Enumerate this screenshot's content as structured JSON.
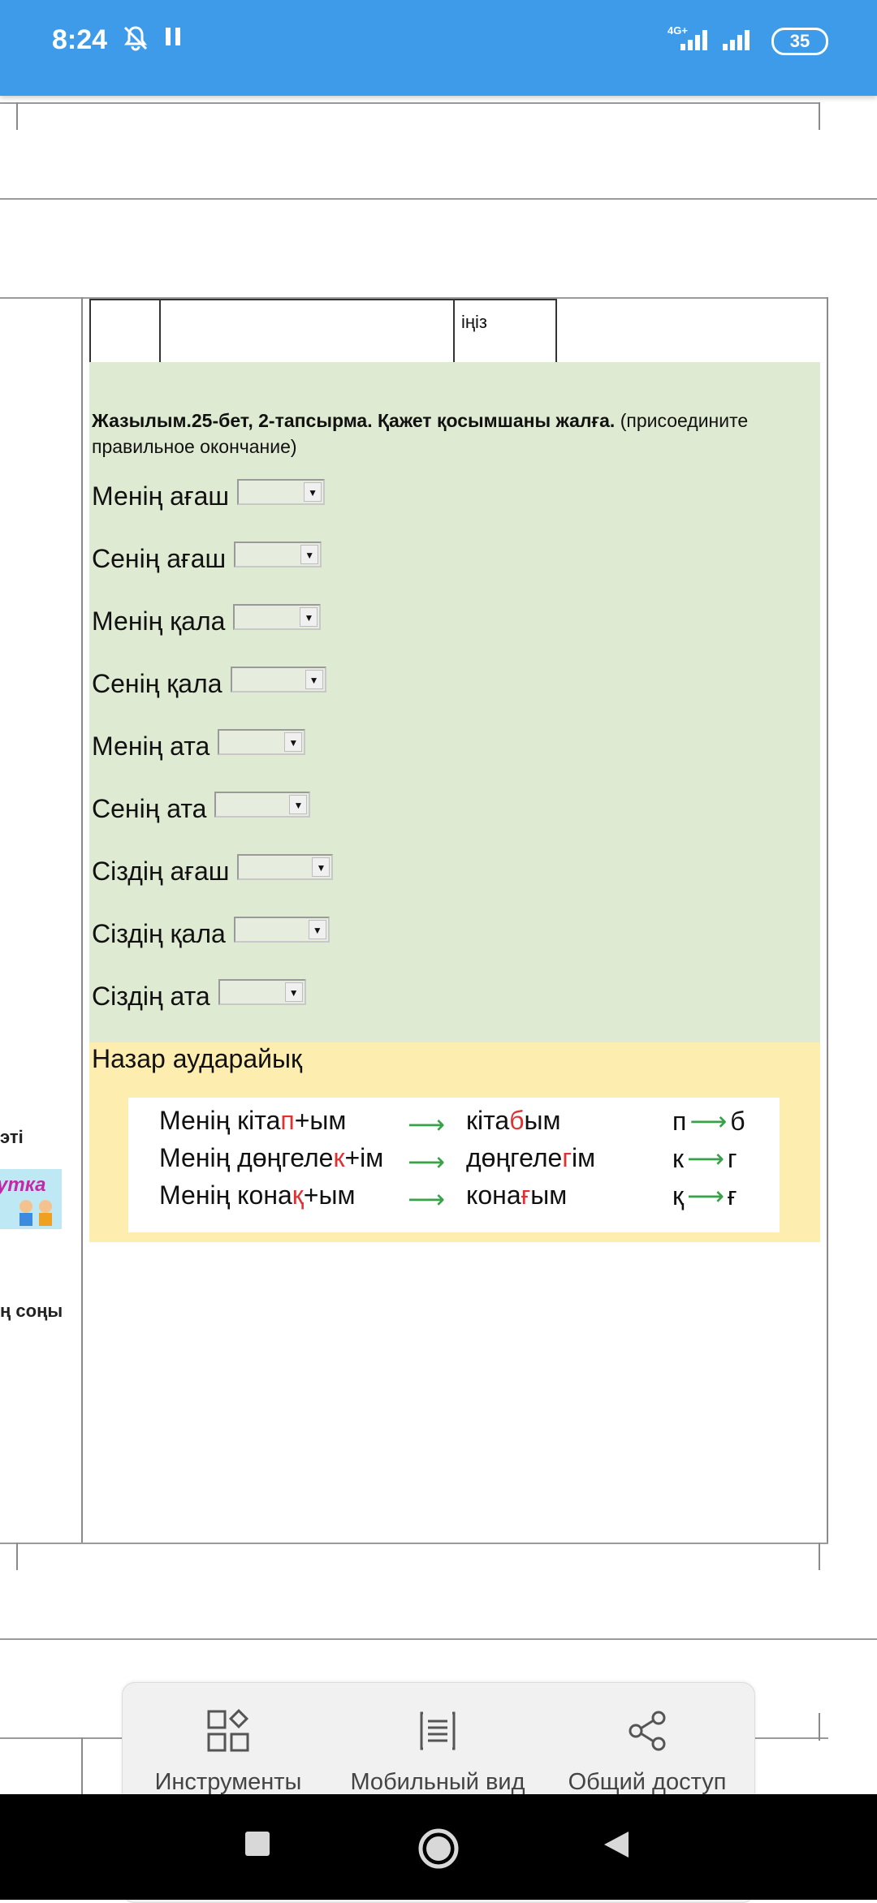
{
  "status_bar": {
    "time": "8:24",
    "network": "4G+",
    "battery": "35"
  },
  "table_fragment": {
    "cell_text": "іңіз"
  },
  "exercise": {
    "title_bold": "Жазылым.25-бет, 2-тапсырма. Қажет қосымшаны жалға.",
    "title_rest": "(присоедините правильное окончание)",
    "items": [
      {
        "text": "Менің ағаш"
      },
      {
        "text": "Сенің ағаш"
      },
      {
        "text": "Менің қала"
      },
      {
        "text": "Сенің қала"
      },
      {
        "text": "Менің ата"
      },
      {
        "text": "Сенің ата"
      },
      {
        "text": "Сіздің ағаш"
      },
      {
        "text": "Сіздің қала"
      },
      {
        "text": "Сіздің ата"
      }
    ]
  },
  "note": {
    "title": "Назар аударайық",
    "rows": [
      {
        "left_a": "Менің кіта",
        "left_red": "п",
        "left_b": "+ым",
        "right_a": "кіта",
        "right_red": "б",
        "right_b": "ым",
        "rule_from": "п",
        "rule_to": "б"
      },
      {
        "left_a": "Менің дөңгеле",
        "left_red": "к",
        "left_b": "+ім",
        "right_a": "дөңгеле",
        "right_red": "г",
        "right_b": "ім",
        "rule_from": "к",
        "rule_to": "г"
      },
      {
        "left_a": "Менің  кона",
        "left_red": "қ",
        "left_b": "+ым",
        "right_a": "кона",
        "right_red": "ғ",
        "right_b": "ым",
        "rule_from": "қ",
        "rule_to": "ғ"
      }
    ]
  },
  "left_column": {
    "text1": "эті",
    "image_label": "утка",
    "text2": "ң соңы"
  },
  "toolbar": {
    "tools_label": "Инструменты",
    "mobile_label": "Мобильный вид",
    "share_label": "Общий доступ"
  }
}
